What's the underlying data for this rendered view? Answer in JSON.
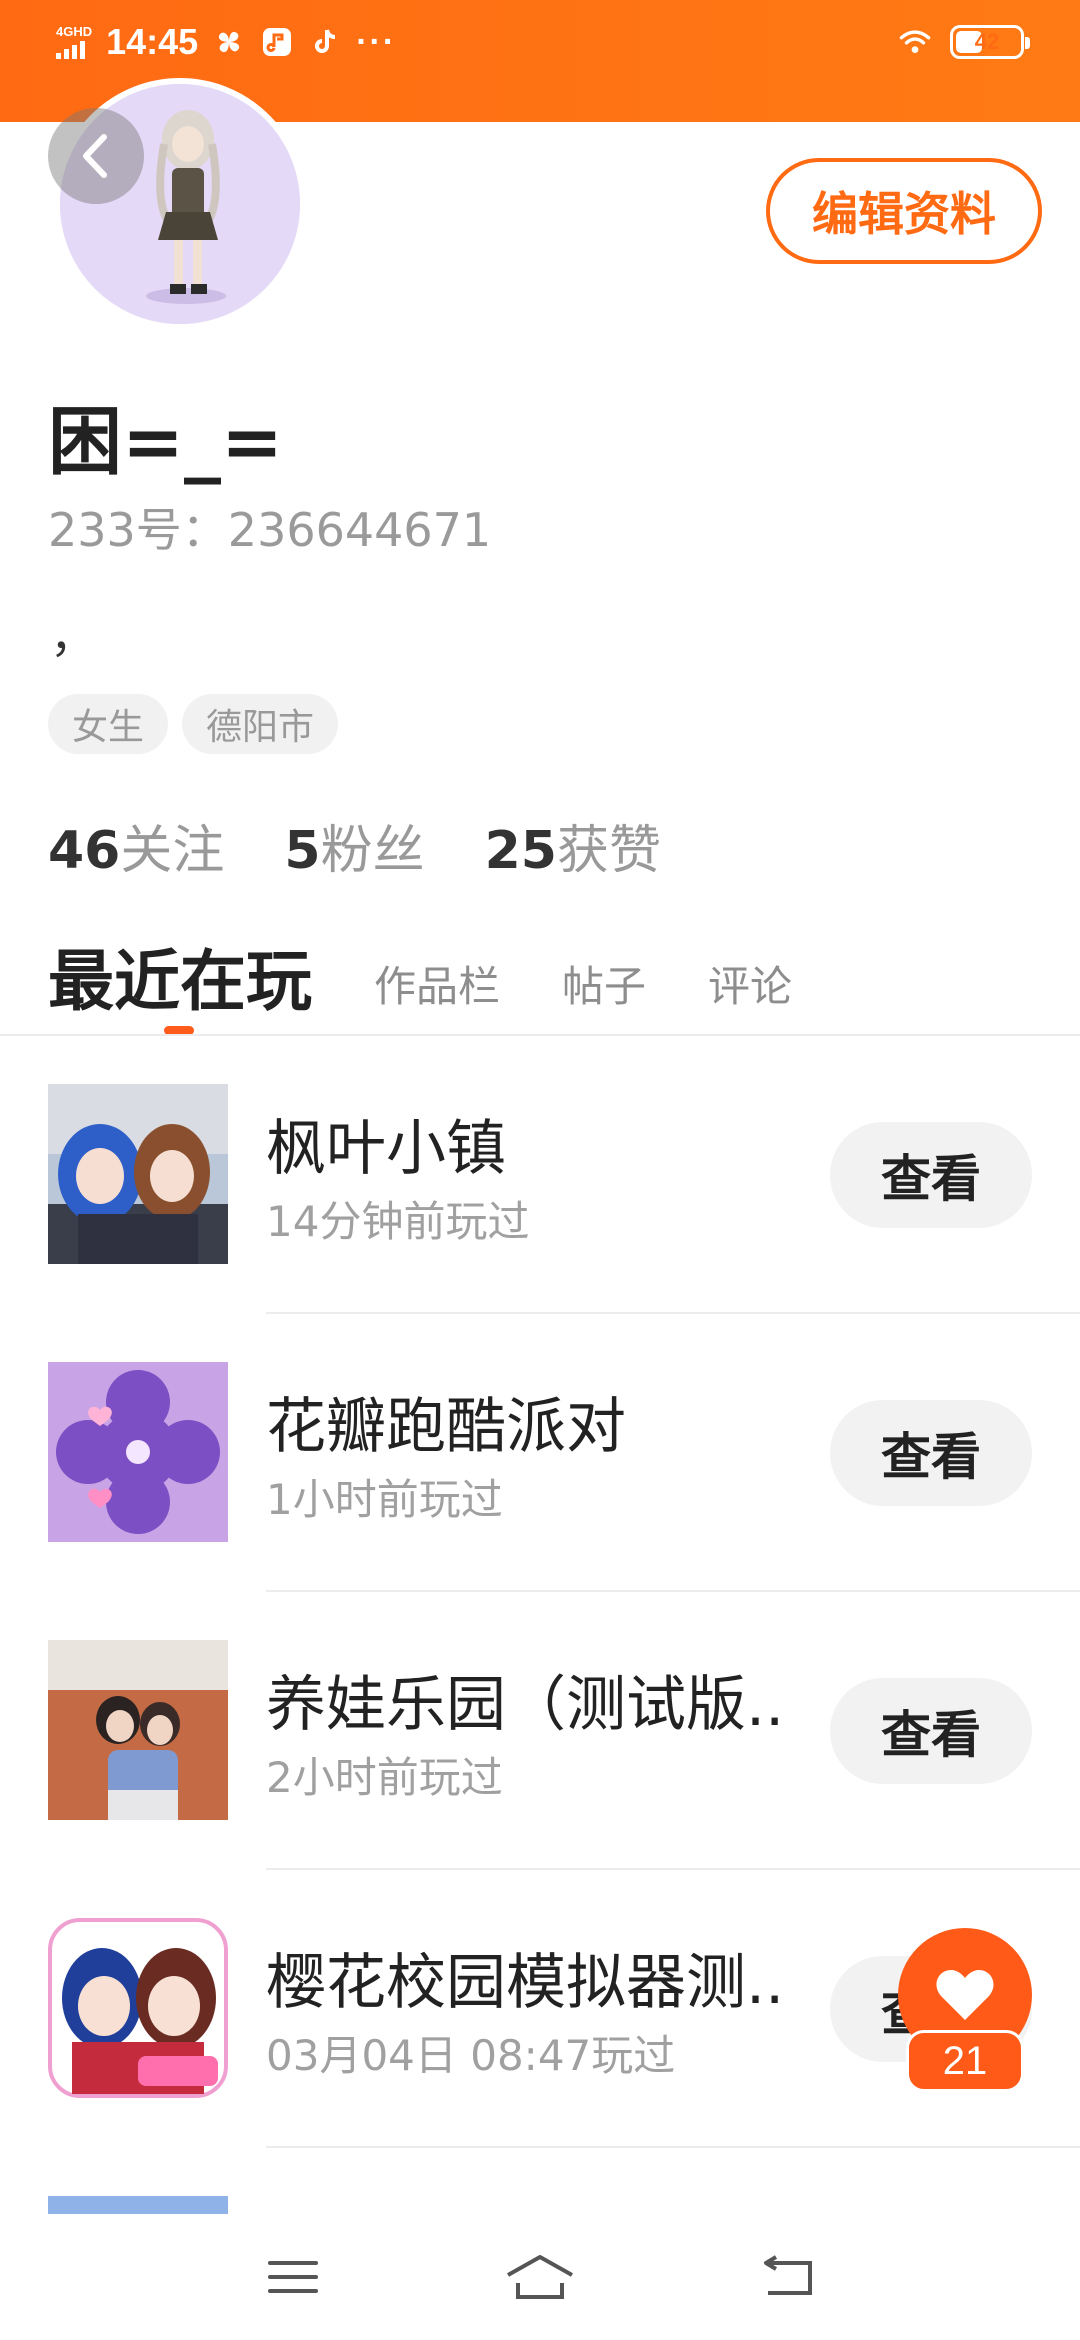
{
  "status_bar": {
    "network": "4GHD",
    "time": "14:45",
    "more": "···",
    "battery": "42",
    "battery_level": 0.42
  },
  "profile": {
    "edit_label": "编辑资料",
    "name": "困=_=",
    "id_text": "233号：236644671",
    "bio": "，",
    "tags": [
      "女生",
      "德阳市"
    ],
    "stats": [
      {
        "num": "46",
        "label": "关注"
      },
      {
        "num": "5",
        "label": "粉丝"
      },
      {
        "num": "25",
        "label": "获赞"
      }
    ]
  },
  "tabs": [
    {
      "label": "最近在玩",
      "active": true
    },
    {
      "label": "作品栏"
    },
    {
      "label": "帖子"
    },
    {
      "label": "评论"
    }
  ],
  "games": [
    {
      "name": "枫叶小镇",
      "time": "14分钟前玩过",
      "button": "查看"
    },
    {
      "name": "花瓣跑酷派对",
      "time": "1小时前玩过",
      "button": "查看"
    },
    {
      "name": "养娃乐园（测试版...",
      "time": "2小时前玩过",
      "button": "查看"
    },
    {
      "name": "樱花校园模拟器测...",
      "time": "03月04日 08:47玩过",
      "button": "查看"
    }
  ],
  "like_fab": {
    "count": "21"
  },
  "icons": {
    "back": "chevron-left-icon",
    "like": "heart-icon",
    "nav": [
      "menu-icon",
      "home-icon",
      "back-arrow-icon"
    ]
  },
  "colors": {
    "accent": "#ff6a13",
    "fab": "#ff5a18",
    "button_bg": "#f2f2f2"
  }
}
